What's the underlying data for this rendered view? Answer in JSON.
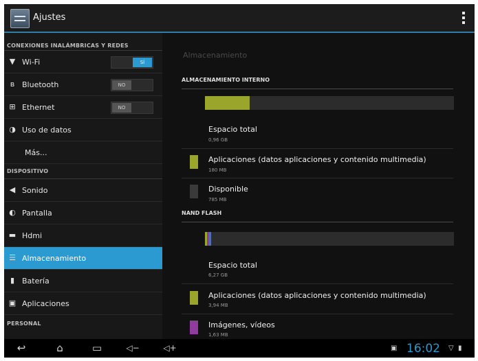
{
  "app": {
    "title": "Ajustes"
  },
  "sidebar": {
    "sections": [
      {
        "header": "CONEXIONES INALÁMBRICAS Y REDES"
      },
      {
        "header": "DISPOSITIVO"
      },
      {
        "header": "PERSONAL"
      }
    ],
    "items": [
      {
        "label": "Wi-Fi",
        "icon": "wifi-icon",
        "toggle": "SÍ"
      },
      {
        "label": "Bluetooth",
        "icon": "bluetooth-icon",
        "toggle": "NO"
      },
      {
        "label": "Ethernet",
        "icon": "ethernet-icon",
        "toggle": "NO"
      },
      {
        "label": "Uso de datos",
        "icon": "data-usage-icon"
      },
      {
        "label": "Más..."
      },
      {
        "label": "Sonido",
        "icon": "speaker-icon"
      },
      {
        "label": "Pantalla",
        "icon": "display-icon"
      },
      {
        "label": "Hdmi",
        "icon": "hdmi-icon"
      },
      {
        "label": "Almacenamiento",
        "icon": "storage-icon",
        "selected": true
      },
      {
        "label": "Batería",
        "icon": "battery-icon"
      },
      {
        "label": "Aplicaciones",
        "icon": "apps-icon"
      }
    ]
  },
  "main": {
    "title": "Almacenamiento",
    "internal": {
      "header": "ALMACENAMIENTO INTERNO",
      "used_fraction": 0.18,
      "entries": [
        {
          "title": "Espacio total",
          "value": "0,96 GB"
        },
        {
          "title": "Aplicaciones (datos aplicaciones y contenido multimedia)",
          "value": "180 MB",
          "color": "#9aa52b"
        },
        {
          "title": "Disponible",
          "value": "785 MB",
          "color": "#3a3a3a"
        }
      ]
    },
    "nand": {
      "header": "NAND FLASH",
      "entries": [
        {
          "title": "Espacio total",
          "value": "6,27 GB"
        },
        {
          "title": "Aplicaciones (datos aplicaciones y contenido multimedia)",
          "value": "3,94 MB",
          "color": "#9aa52b"
        },
        {
          "title": "Imágenes, vídeos",
          "value": "1,63 MB",
          "color": "#8e3d9e"
        }
      ]
    }
  },
  "statusbar": {
    "time": "16:02"
  },
  "colors": {
    "accent": "#2a9ad0",
    "apps": "#9aa52b",
    "media": "#8e3d9e"
  }
}
